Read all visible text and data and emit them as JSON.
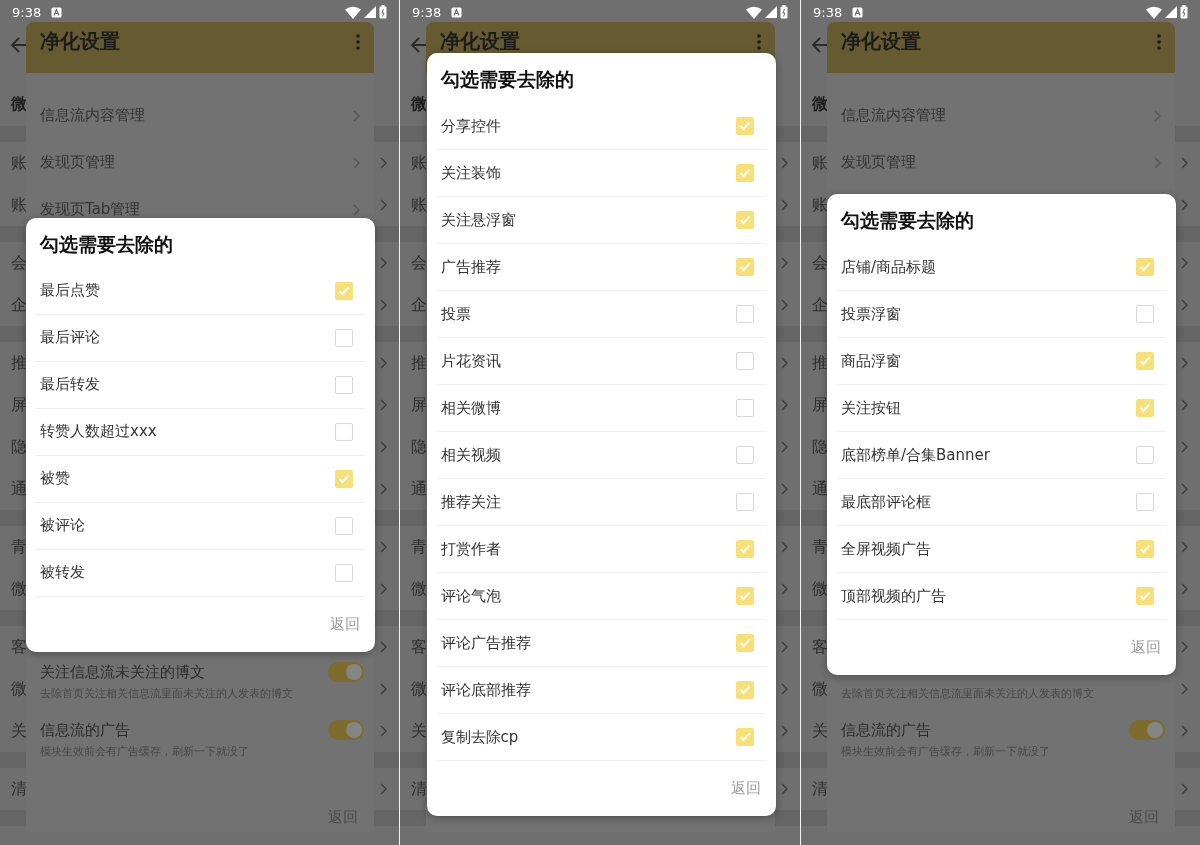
{
  "phones": [
    {
      "status_bar": {
        "time": "9:38"
      },
      "background_page": {
        "groups": [
          {
            "rows": [
              {
                "kind": "heading",
                "label": "微"
              }
            ]
          },
          {
            "rows": [
              {
                "kind": "item",
                "label": "账"
              },
              {
                "kind": "item",
                "label": "账"
              }
            ]
          },
          {
            "rows": [
              {
                "kind": "item",
                "label": "会"
              },
              {
                "kind": "item",
                "label": "企"
              }
            ]
          },
          {
            "rows": [
              {
                "kind": "item",
                "label": "推"
              },
              {
                "kind": "item",
                "label": "屏"
              },
              {
                "kind": "item",
                "label": "隐"
              },
              {
                "kind": "item",
                "label": "通"
              }
            ]
          },
          {
            "rows": [
              {
                "kind": "item",
                "label": "青"
              },
              {
                "kind": "item",
                "label": "微"
              }
            ]
          },
          {
            "rows": [
              {
                "kind": "item",
                "label": "客"
              },
              {
                "kind": "item",
                "label": "微"
              },
              {
                "kind": "item",
                "label": "关"
              }
            ]
          },
          {
            "rows": [
              {
                "kind": "item",
                "label": "清"
              }
            ]
          }
        ]
      },
      "settings_dialog": {
        "title": "净化设置",
        "upper_items": [
          {
            "kind": "link",
            "label": "信息流内容管理"
          },
          {
            "kind": "link",
            "label": "发现页管理"
          },
          {
            "kind": "link",
            "label": "发现页Tab管理"
          }
        ],
        "lower_items": [
          {
            "kind": "switch",
            "label": "关注信息流未关注的博文",
            "subtitle": "去除首页关注相关信息流里面未关注的人发表的博文",
            "on": true
          },
          {
            "kind": "switch",
            "label": "信息流的广告",
            "subtitle": "模块生效前会有广告缓存，刷新一下就没了",
            "on": true
          }
        ],
        "footer": "返回"
      },
      "checklist_dialog": {
        "title": "勾选需要去除的",
        "items": [
          {
            "label": "最后点赞",
            "checked": true
          },
          {
            "label": "最后评论",
            "checked": false
          },
          {
            "label": "最后转发",
            "checked": false
          },
          {
            "label": "转赞人数超过xxx",
            "checked": false
          },
          {
            "label": "被赞",
            "checked": true
          },
          {
            "label": "被评论",
            "checked": false
          },
          {
            "label": "被转发",
            "checked": false
          }
        ],
        "footer": "返回"
      }
    },
    {
      "status_bar": {
        "time": "9:38"
      },
      "background_page": {
        "groups": [
          {
            "rows": [
              {
                "kind": "heading",
                "label": "微"
              }
            ]
          },
          {
            "rows": [
              {
                "kind": "item",
                "label": "账"
              },
              {
                "kind": "item",
                "label": "账"
              }
            ]
          },
          {
            "rows": [
              {
                "kind": "item",
                "label": "会"
              },
              {
                "kind": "item",
                "label": "企"
              }
            ]
          },
          {
            "rows": [
              {
                "kind": "item",
                "label": "推"
              },
              {
                "kind": "item",
                "label": "屏"
              },
              {
                "kind": "item",
                "label": "隐"
              },
              {
                "kind": "item",
                "label": "通"
              }
            ]
          },
          {
            "rows": [
              {
                "kind": "item",
                "label": "青"
              },
              {
                "kind": "item",
                "label": "微"
              }
            ]
          },
          {
            "rows": [
              {
                "kind": "item",
                "label": "客"
              },
              {
                "kind": "item",
                "label": "微"
              },
              {
                "kind": "item",
                "label": "关"
              }
            ]
          },
          {
            "rows": [
              {
                "kind": "item",
                "label": "清"
              }
            ]
          }
        ]
      },
      "settings_dialog": {
        "title": "净化设置"
      },
      "checklist_dialog": {
        "title": "勾选需要去除的",
        "items": [
          {
            "label": "分享控件",
            "checked": true
          },
          {
            "label": "关注装饰",
            "checked": true
          },
          {
            "label": "关注悬浮窗",
            "checked": true
          },
          {
            "label": "广告推荐",
            "checked": true
          },
          {
            "label": "投票",
            "checked": false
          },
          {
            "label": "片花资讯",
            "checked": false
          },
          {
            "label": "相关微博",
            "checked": false
          },
          {
            "label": "相关视频",
            "checked": false
          },
          {
            "label": "推荐关注",
            "checked": false
          },
          {
            "label": "打赏作者",
            "checked": true
          },
          {
            "label": "评论气泡",
            "checked": true
          },
          {
            "label": "评论广告推荐",
            "checked": true
          },
          {
            "label": "评论底部推荐",
            "checked": true
          },
          {
            "label": "复制去除cp",
            "checked": true
          }
        ],
        "footer": "返回"
      }
    },
    {
      "status_bar": {
        "time": "9:38"
      },
      "background_page": {
        "groups": [
          {
            "rows": [
              {
                "kind": "heading",
                "label": "微"
              }
            ]
          },
          {
            "rows": [
              {
                "kind": "item",
                "label": "账"
              },
              {
                "kind": "item",
                "label": "账"
              }
            ]
          },
          {
            "rows": [
              {
                "kind": "item",
                "label": "会"
              },
              {
                "kind": "item",
                "label": "企"
              }
            ]
          },
          {
            "rows": [
              {
                "kind": "item",
                "label": "推"
              },
              {
                "kind": "item",
                "label": "屏"
              },
              {
                "kind": "item",
                "label": "隐"
              },
              {
                "kind": "item",
                "label": "通"
              }
            ]
          },
          {
            "rows": [
              {
                "kind": "item",
                "label": "青"
              },
              {
                "kind": "item",
                "label": "微"
              }
            ]
          },
          {
            "rows": [
              {
                "kind": "item",
                "label": "客"
              },
              {
                "kind": "item",
                "label": "微"
              },
              {
                "kind": "item",
                "label": "关"
              }
            ]
          },
          {
            "rows": [
              {
                "kind": "item",
                "label": "清"
              }
            ]
          }
        ]
      },
      "settings_dialog": {
        "title": "净化设置",
        "upper_items": [
          {
            "kind": "link",
            "label": "信息流内容管理"
          },
          {
            "kind": "link",
            "label": "发现页管理"
          }
        ],
        "lower_items": [
          {
            "kind": "switch",
            "subtitle": "去除首页关注相关信息流里面未关注的人发表的博文"
          },
          {
            "kind": "switch",
            "label": "信息流的广告",
            "subtitle": "模块生效前会有广告缓存，刷新一下就没了",
            "on": true
          }
        ],
        "footer": "返回"
      },
      "checklist_dialog": {
        "title": "勾选需要去除的",
        "items": [
          {
            "label": "店铺/商品标题",
            "checked": true
          },
          {
            "label": "投票浮窗",
            "checked": false
          },
          {
            "label": "商品浮窗",
            "checked": true
          },
          {
            "label": "关注按钮",
            "checked": true
          },
          {
            "label": "底部榜单/合集Banner",
            "checked": false
          },
          {
            "label": "最底部评论框",
            "checked": false
          },
          {
            "label": "全屏视频广告",
            "checked": true
          },
          {
            "label": "顶部视频的广告",
            "checked": true
          }
        ],
        "footer": "返回"
      }
    }
  ]
}
